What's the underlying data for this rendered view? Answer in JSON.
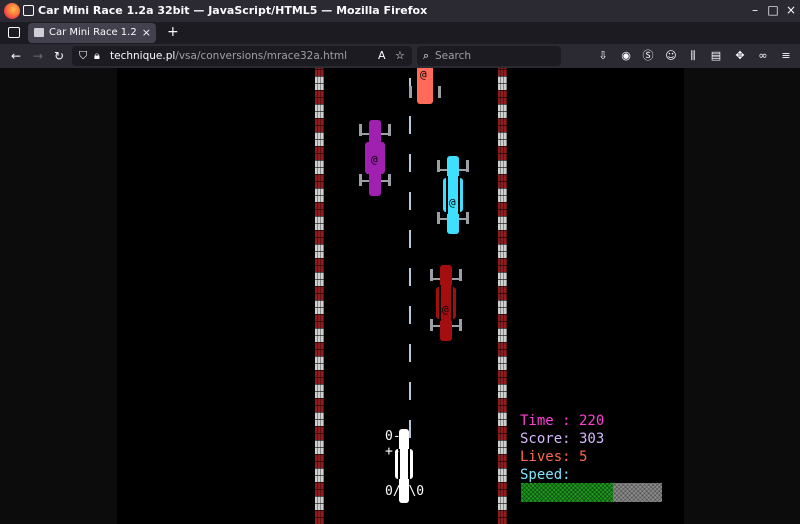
{
  "window": {
    "title": "Car Mini Race 1.2a 32bit — JavaScript/HTML5 — Mozilla Firefox",
    "controls": {
      "minimize": "–",
      "maximize": "□",
      "close": "×"
    }
  },
  "tabs": [
    {
      "label": "Car Mini Race 1.2a 32bit",
      "close": "×"
    }
  ],
  "new_tab": "+",
  "nav": {
    "back": "←",
    "forward": "→",
    "reload": "↻",
    "url_host": "technique.pl",
    "url_path": "/vsa/conversions/mrace32a.html",
    "search_placeholder": "Search"
  },
  "game": {
    "hud": {
      "time_label": "Time : 220",
      "score_label": "Score: 303",
      "lives_label": "Lives: 5",
      "speed_label": "Speed:",
      "speed_fraction": 0.65
    },
    "colors": {
      "time": "#ff3fd6",
      "score": "#d7b8ff",
      "lives": "#ff6a4f",
      "speed": "#7fe6ff",
      "speed_fill": "#1e9a1e"
    },
    "player_wheel_text": "0-+-0",
    "player_wheel_text_bottom": "0/+\\0",
    "car_glyph": "@"
  }
}
